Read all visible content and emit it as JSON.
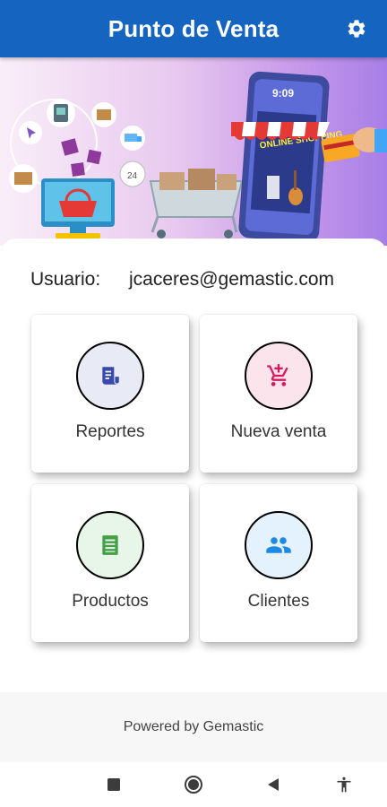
{
  "app": {
    "title": "Punto de Venta",
    "settings_icon": "gear-icon",
    "primary_color": "#1565c0"
  },
  "hero": {
    "phone_time": "9:09",
    "phone_sign": "ONLINE SHOPPING"
  },
  "user": {
    "label": "Usuario:",
    "email": "jcaceres@gemastic.com"
  },
  "tiles": [
    {
      "label": "Reportes",
      "icon": "receipt-icon",
      "color": "#3949ab"
    },
    {
      "label": "Nueva venta",
      "icon": "cart-add-icon",
      "color": "#d81b60"
    },
    {
      "label": "Productos",
      "icon": "list-icon",
      "color": "#43a047"
    },
    {
      "label": "Clientes",
      "icon": "people-icon",
      "color": "#1e88e5"
    }
  ],
  "footer": {
    "text": "Powered by Gemastic"
  },
  "navbar": {
    "recents_icon": "square-icon",
    "home_icon": "circle-icon",
    "back_icon": "triangle-back-icon",
    "accessibility_icon": "accessibility-icon"
  }
}
